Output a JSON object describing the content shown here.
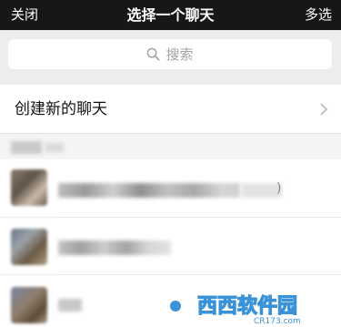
{
  "nav": {
    "close_label": "关闭",
    "title": "选择一个聊天",
    "multi_select_label": "多选"
  },
  "search": {
    "placeholder": "搜索",
    "icon": "search-icon"
  },
  "create_chat": {
    "label": "创建新的聊天",
    "icon": "chevron-right-icon"
  },
  "watermark": {
    "brand": "西西软件园",
    "domain": "CR173.com"
  },
  "colors": {
    "topbar": "#171717",
    "background": "#ededed",
    "accent": "#ffffff"
  }
}
